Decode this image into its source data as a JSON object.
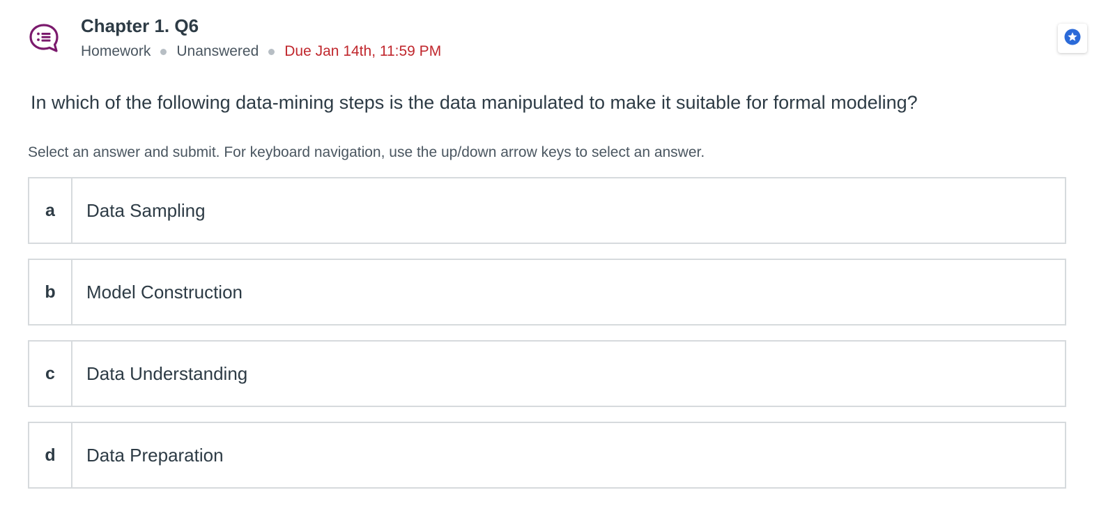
{
  "header": {
    "icon": "question-chat-icon",
    "title": "Chapter 1. Q6",
    "type": "Homework",
    "status": "Unanswered",
    "due": "Due Jan 14th, 11:59 PM",
    "bookmark_icon": "star-icon"
  },
  "question": {
    "text": "In which of the following data-mining steps is the data manipulated to make it suitable for formal modeling?",
    "instructions": "Select an answer and submit. For keyboard navigation, use the up/down arrow keys to select an answer."
  },
  "options": [
    {
      "letter": "a",
      "text": "Data Sampling"
    },
    {
      "letter": "b",
      "text": "Model Construction"
    },
    {
      "letter": "c",
      "text": "Data Understanding"
    },
    {
      "letter": "d",
      "text": "Data Preparation"
    }
  ],
  "colors": {
    "icon_purple": "#7b1a6d",
    "due_red": "#c0272d",
    "bookmark_blue": "#2b6ad8",
    "border": "#d6dadd"
  }
}
